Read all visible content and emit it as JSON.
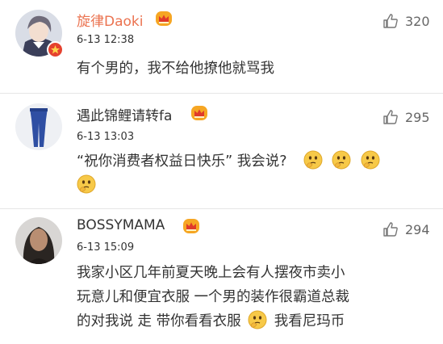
{
  "comments": [
    {
      "username": "旋律Daoki",
      "timestamp": "6-13 12:38",
      "likes": "320",
      "lines": [
        "有个男的，我不给他撩他就骂我"
      ]
    },
    {
      "username": "遇此锦鲤请转fa",
      "timestamp": "6-13 13:03",
      "likes": "295",
      "lines": [
        "“祝你消费者权益日快乐” 我会说?"
      ]
    },
    {
      "username": "BOSSYMAMA",
      "timestamp": "6-13 15:09",
      "likes": "294",
      "lines": [
        "我家小区几年前夏天晚上会有人摆夜市卖小",
        "玩意儿和便宜衣服  一个男的装作很霸道总裁",
        "的对我说 走 带你看看衣服",
        "我看尼玛币"
      ]
    }
  ],
  "colors": {
    "username_vip": "#eb7350",
    "crown": "#f6a623",
    "verified_badge": "#e5422f",
    "emoji_face": "#f7c948"
  },
  "icons": {
    "like": "thumbs-up-icon",
    "crown": "crown-icon",
    "verified": "verified-star-icon",
    "emoji": "thinking-face-emoji"
  }
}
